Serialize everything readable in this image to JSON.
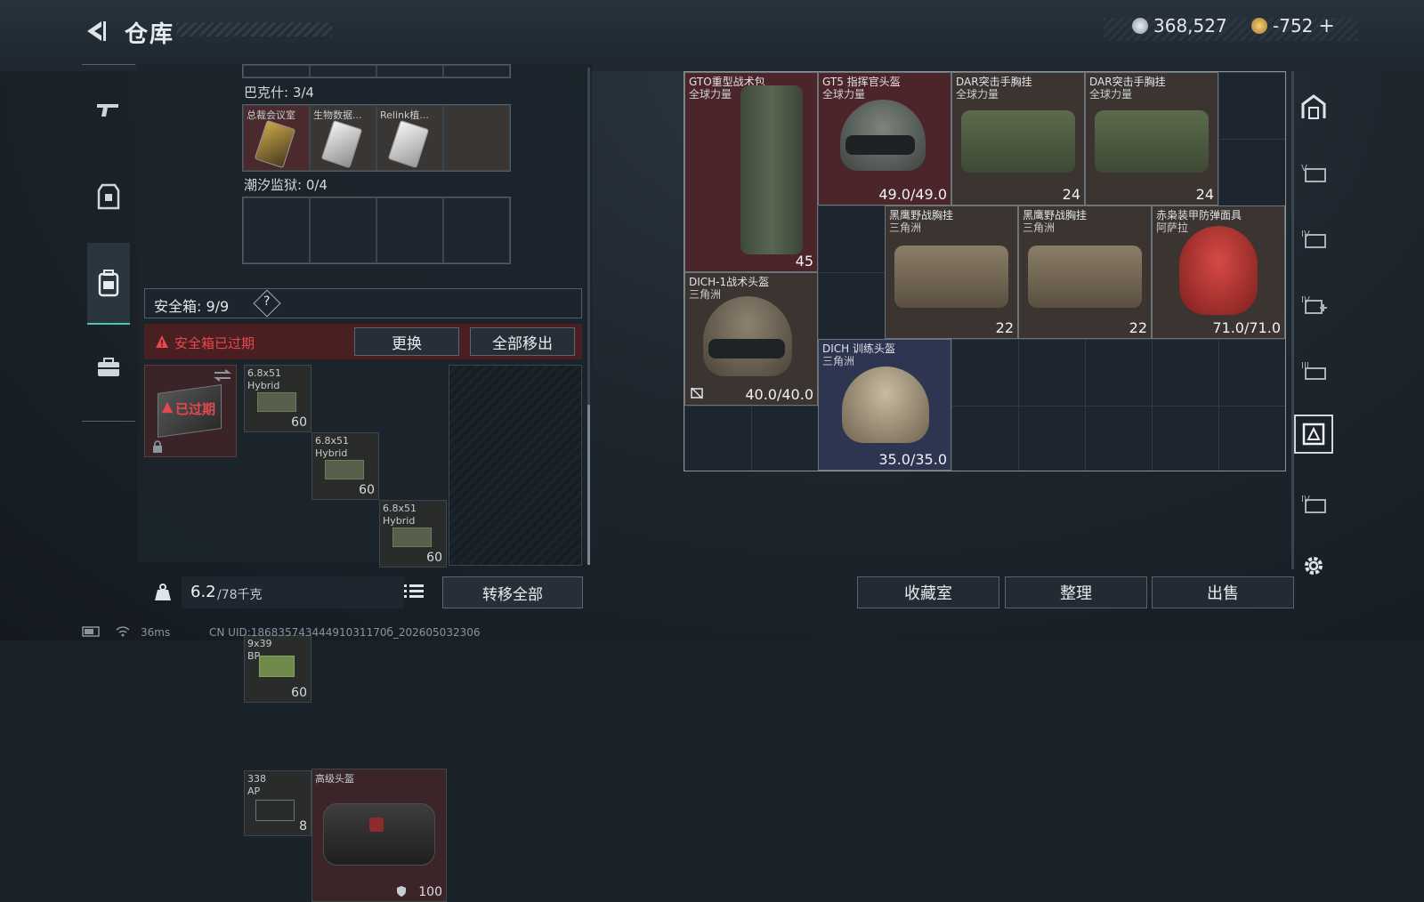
{
  "header": {
    "title": "仓库",
    "currency_main": "368,527",
    "currency_secondary": "-752",
    "add_symbol": "+"
  },
  "left_rail": [
    {
      "icon": "weapon-icon"
    },
    {
      "icon": "armor-vest-icon"
    },
    {
      "icon": "backpack-icon",
      "active": true
    },
    {
      "icon": "briefcase-icon"
    }
  ],
  "left_panel": {
    "bakesh_label": "巴克什: 3/4",
    "bakesh_items": [
      {
        "name": "总裁会议室"
      },
      {
        "name": "生物数据..."
      },
      {
        "name": "Relink植..."
      }
    ],
    "tidal_label": "潮汐监狱: 0/4",
    "safe_label": "安全箱: 9/9",
    "safe_help": "?",
    "expired_warning": "安全箱已过期",
    "replace_button": "更换",
    "remove_all_button": "全部移出",
    "safebox_status": "已过期",
    "safe_items": [
      {
        "name": "6.8x51",
        "sub": "Hybrid",
        "count": "60"
      },
      {
        "name": "6.8x51",
        "sub": "Hybrid",
        "count": "60"
      },
      {
        "name": "6.8x51",
        "sub": "Hybrid",
        "count": "60"
      },
      {
        "name": "9x39",
        "sub": "BP",
        "count": "60"
      },
      {
        "name": "338",
        "sub": "AP",
        "count": "8"
      }
    ],
    "bag_item": {
      "name": "高级头盔",
      "durability": "100"
    },
    "weight_value": "6.2",
    "weight_max": "/78千克",
    "transfer_all_button": "转移全部"
  },
  "storage_items": [
    {
      "name": "GTO重型战术包",
      "source": "全球力量",
      "value": "45"
    },
    {
      "name": "GT5 指挥官头盔",
      "source": "全球力量",
      "value": "49.0/49.0"
    },
    {
      "name": "DAR突击手胸挂",
      "source": "全球力量",
      "value": "24"
    },
    {
      "name": "DAR突击手胸挂",
      "source": "全球力量",
      "value": "24"
    },
    {
      "name": "黑鹰野战胸挂",
      "source": "三角洲",
      "value": "22"
    },
    {
      "name": "黑鹰野战胸挂",
      "source": "三角洲",
      "value": "22"
    },
    {
      "name": "赤枭装甲防弹面具",
      "source": "阿萨拉",
      "value": "71.0/71.0"
    },
    {
      "name": "DICH-1战术头盔",
      "source": "三角洲",
      "value": "40.0/40.0"
    },
    {
      "name": "DICH 训练头盔",
      "source": "三角洲",
      "value": "35.0/35.0"
    }
  ],
  "bottom_buttons": {
    "collection": "收藏室",
    "organize": "整理",
    "sell": "出售"
  },
  "status_bar": {
    "ping": "36ms",
    "uid": "CN UID:18683574344491031170б_202605032306"
  },
  "colors": {
    "accent": "#4ec7b1",
    "warning": "#e5484d",
    "red_slot": "#4c252a",
    "blue_slot": "#2e3550"
  }
}
